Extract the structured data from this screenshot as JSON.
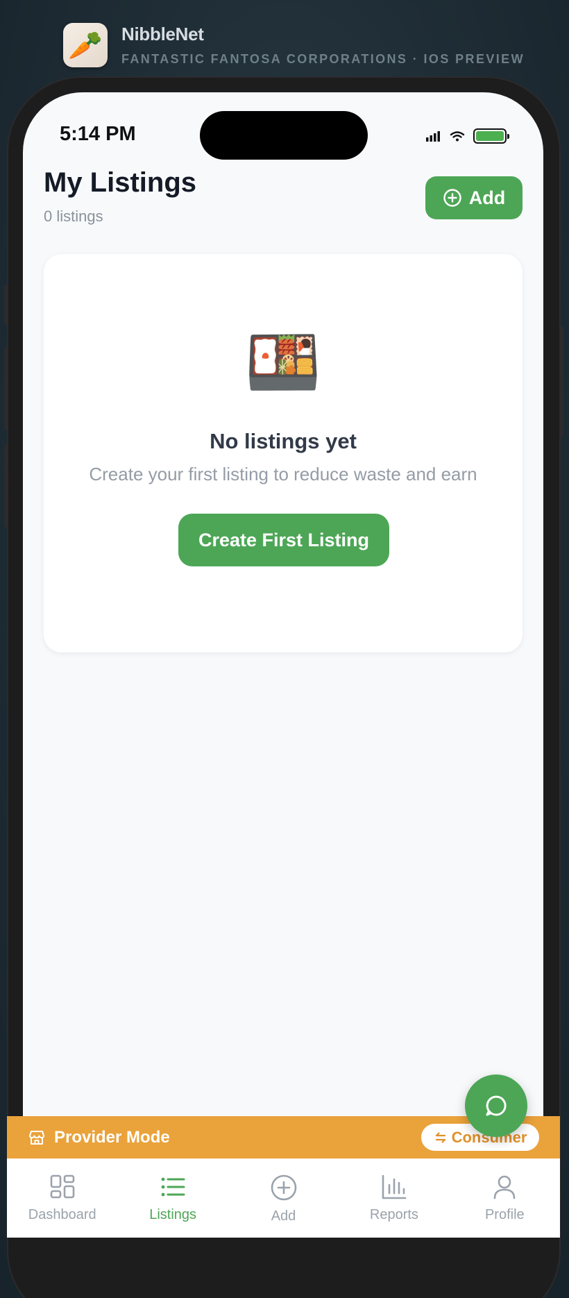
{
  "app": {
    "name": "NibbleNet",
    "subtitle": "FANTASTIC FANTOSA CORPORATIONS · IOS PREVIEW",
    "icon": "carrot-icon"
  },
  "status_bar": {
    "time": "5:14 PM",
    "battery_color": "#4caf50"
  },
  "header": {
    "title": "My Listings",
    "count": "0 listings",
    "add_label": "Add"
  },
  "empty_state": {
    "icon_glyph": "🍱",
    "title": "No listings yet",
    "description": "Create your first listing to reduce waste and earn",
    "cta_label": "Create First Listing"
  },
  "mode_bar": {
    "label": "Provider Mode",
    "switch_label": "Consumer",
    "color": "#eaa23a"
  },
  "tabs": [
    {
      "label": "Dashboard",
      "icon": "dashboard-icon",
      "active": false
    },
    {
      "label": "Listings",
      "icon": "list-icon",
      "active": true
    },
    {
      "label": "Add",
      "icon": "plus-circle-icon",
      "active": false
    },
    {
      "label": "Reports",
      "icon": "bar-chart-icon",
      "active": false
    },
    {
      "label": "Profile",
      "icon": "user-icon",
      "active": false
    }
  ],
  "colors": {
    "accent": "#4da656",
    "background": "#f8f9fb"
  }
}
